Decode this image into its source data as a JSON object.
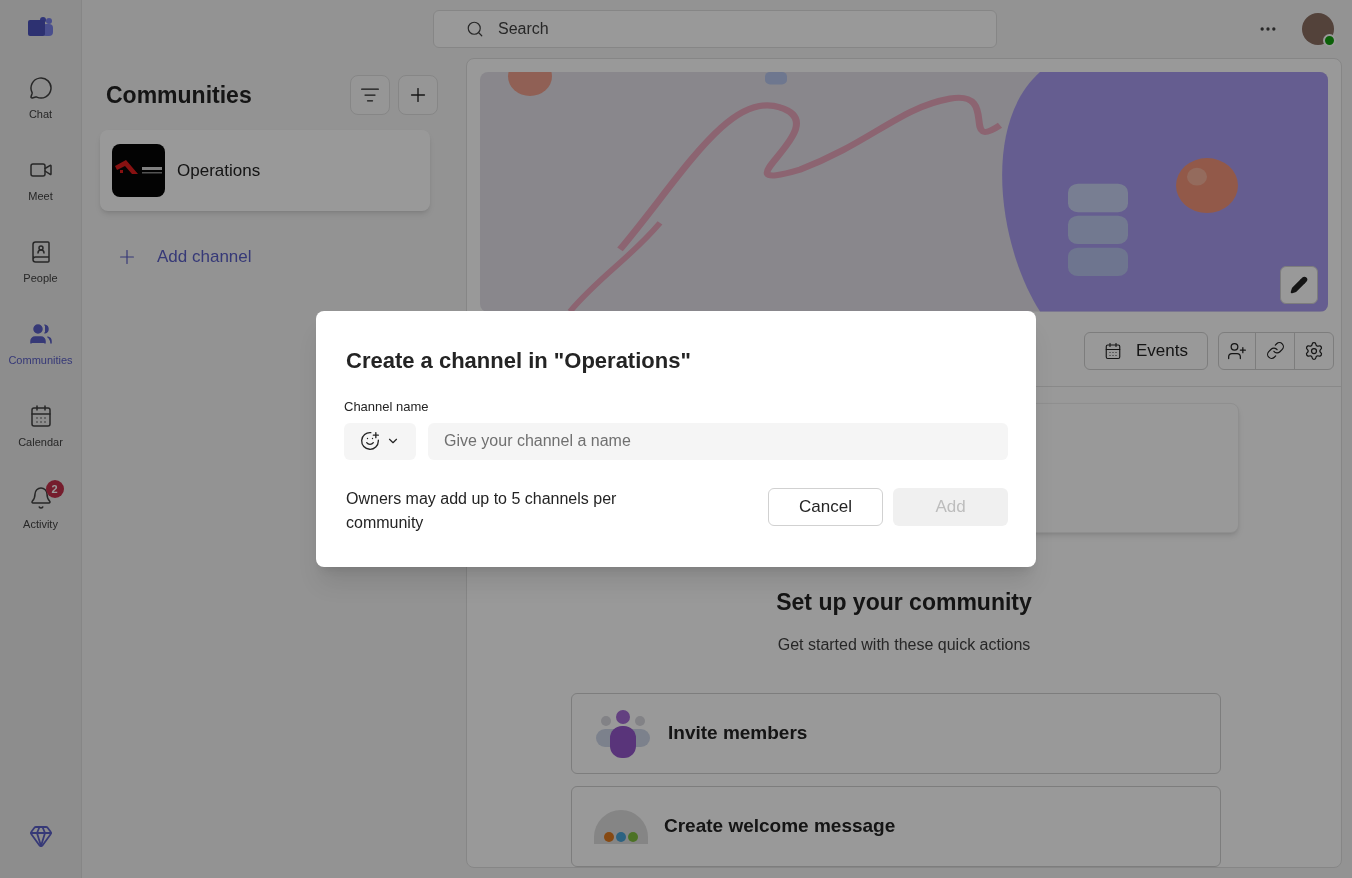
{
  "rail": {
    "items": [
      {
        "label": "Chat",
        "selected": false
      },
      {
        "label": "Meet",
        "selected": false
      },
      {
        "label": "People",
        "selected": false
      },
      {
        "label": "Communities",
        "selected": true
      },
      {
        "label": "Calendar",
        "selected": false
      },
      {
        "label": "Activity",
        "selected": false,
        "badge": "2"
      }
    ]
  },
  "search": {
    "placeholder": "Search"
  },
  "communities": {
    "title": "Communities",
    "items": [
      {
        "name": "Operations",
        "selected": true
      }
    ],
    "add_channel": "Add channel"
  },
  "community_page": {
    "events": "Events",
    "setup": {
      "title": "Set up your community",
      "subtitle": "Get started with these quick actions",
      "actions": [
        "Invite members",
        "Create welcome message"
      ]
    }
  },
  "dialog": {
    "title": "Create a channel in \"Operations\"",
    "field_label": "Channel name",
    "placeholder": "Give your channel a name",
    "note": "Owners may add up to 5 channels per community",
    "buttons": [
      {
        "label": "Cancel",
        "disabled": false
      },
      {
        "label": "Add",
        "disabled": true
      }
    ]
  }
}
